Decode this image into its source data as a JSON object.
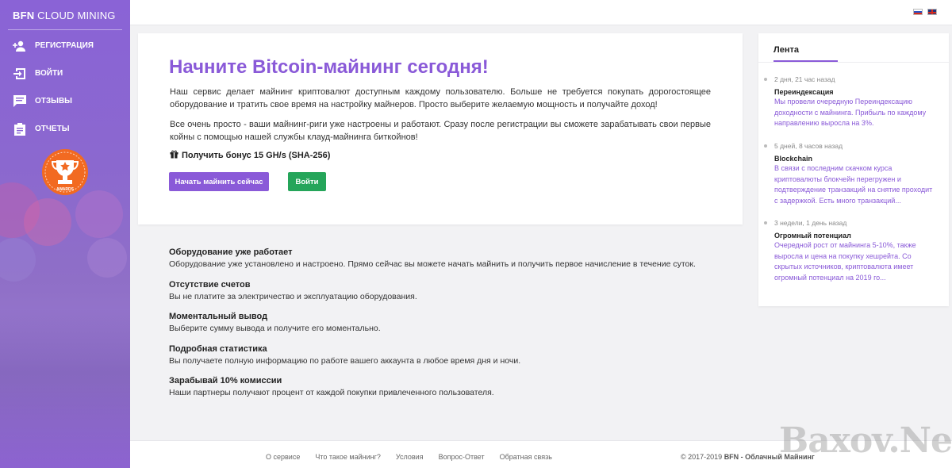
{
  "brand": {
    "prefix": "BFN",
    "name": "CLOUD MINING"
  },
  "sidebar": {
    "items": [
      {
        "label": "РЕГИСТРАЦИЯ",
        "icon": "add-user-icon"
      },
      {
        "label": "ВОЙТИ",
        "icon": "login-icon"
      },
      {
        "label": "ОТЗЫВЫ",
        "icon": "comment-icon"
      },
      {
        "label": "ОТЧЕТЫ",
        "icon": "clipboard-icon"
      }
    ],
    "award_label": "AWARDS"
  },
  "topbar": {
    "languages": [
      "ru",
      "en"
    ]
  },
  "hero": {
    "title": "Начните Bitcoin-майнинг сегодня!",
    "paragraph1": "Наш сервис делает майнинг криптовалют доступным каждому пользователю. Больше не требуется покупать дорогостоящее оборудование и тратить свое время на настройку майнеров. Просто выберите желаемую мощность и получайте доход!",
    "paragraph2": "Все очень просто - ваши майнинг-риги уже настроены и работают. Сразу после регистрации вы сможете зарабатывать свои первые койны с помощью нашей службы клауд-майнинга биткойнов!",
    "bonus": "Получить бонус 15 GH/s (SHA-256)",
    "start_button": "Начать майнить сейчас",
    "login_button": "Войти"
  },
  "features": [
    {
      "title": "Оборудование уже работает",
      "text": "Оборудование уже установлено и настроено. Прямо сейчас вы можете начать майнить и получить первое начисление в течение суток."
    },
    {
      "title": "Отсутствие счетов",
      "text": "Вы не платите за электричество и эксплуатацию оборудования."
    },
    {
      "title": "Моментальный вывод",
      "text": "Выберите сумму вывода и получите его моментально."
    },
    {
      "title": "Подробная статистика",
      "text": "Вы получаете полную информацию по работе вашего аккаунта в любое время дня и ночи."
    },
    {
      "title": "Зарабывай 10% комиссии",
      "text": "Наши партнеры получают процент от каждой покупки привлеченного пользователя."
    }
  ],
  "feed": {
    "title": "Лента",
    "items": [
      {
        "time": "2 дня, 21 час назад",
        "title": "Переиндексация",
        "text": "Мы провели очередную Переиндексацию доходности с майнинга. Прибыль по каждому направлению выросла на 3%."
      },
      {
        "time": "5 дней, 8 часов назад",
        "title": "Blockchain",
        "text": "В связи с последним скачком курса криптовалюты блокчейн перегружен и подтверждение транзакций на снятие проходит с задержкой. Есть много транзакций..."
      },
      {
        "time": "3 недели, 1 день назад",
        "title": "Огромный потенциал",
        "text": "Очередной рост от майнинга 5-10%, также выросла и цена на покупку хешрейта. Со скрытых источников, криптовалюта имеет огромный потенциал на 2019 го..."
      }
    ]
  },
  "footer": {
    "links": [
      "О сервисе",
      "Что такое майнинг?",
      "Условия",
      "Вопрос-Ответ",
      "Обратная связь"
    ],
    "copyright_prefix": "© 2017-2019",
    "copyright_brand": "BFN - Облачный Майнинг"
  },
  "watermark": "Baxov.Net",
  "colors": {
    "accent": "#8a5ad8",
    "success": "#25a55a",
    "sidebar": "#8a63d6"
  }
}
